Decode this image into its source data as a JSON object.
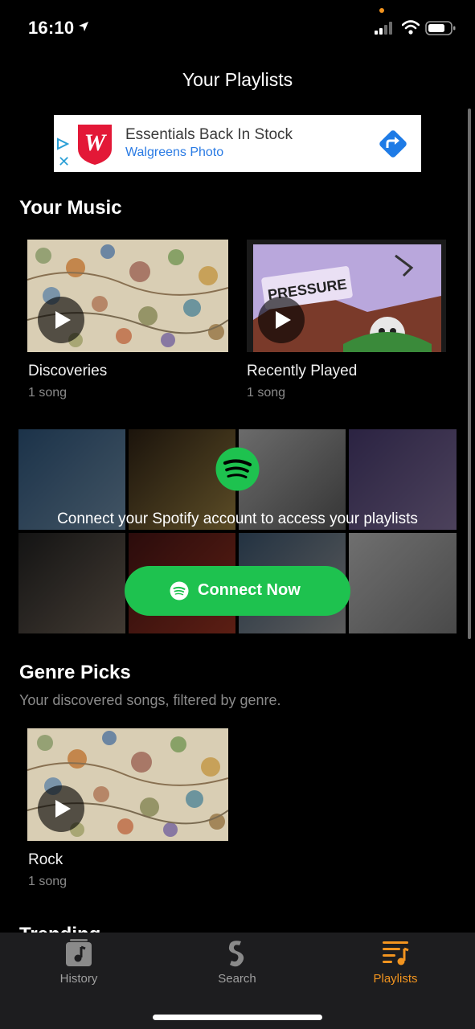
{
  "status_bar": {
    "time": "16:10"
  },
  "header": {
    "title": "Your Playlists"
  },
  "ad": {
    "headline": "Essentials Back In Stock",
    "subline": "Walgreens Photo",
    "close_glyph": "✕",
    "brand_color": "#e31837",
    "link_color": "#2a7be4"
  },
  "your_music": {
    "heading": "Your Music",
    "cards": [
      {
        "title": "Discoveries",
        "count": "1 song"
      },
      {
        "title": "Recently Played",
        "count": "1 song"
      }
    ]
  },
  "spotify": {
    "message": "Connect your Spotify account to access your playlists",
    "button_label": "Connect Now",
    "accent": "#1ec24f"
  },
  "genre_picks": {
    "heading": "Genre Picks",
    "subtitle": "Your discovered songs, filtered by genre.",
    "cards": [
      {
        "title": "Rock",
        "count": "1 song"
      }
    ]
  },
  "trending": {
    "heading": "Trending"
  },
  "tabbar": {
    "tabs": [
      {
        "label": "History",
        "icon": "music-note-icon"
      },
      {
        "label": "Search",
        "icon": "shazam-logo-icon"
      },
      {
        "label": "Playlists",
        "icon": "playlist-icon",
        "active": true
      }
    ],
    "active_color": "#f2941f"
  }
}
